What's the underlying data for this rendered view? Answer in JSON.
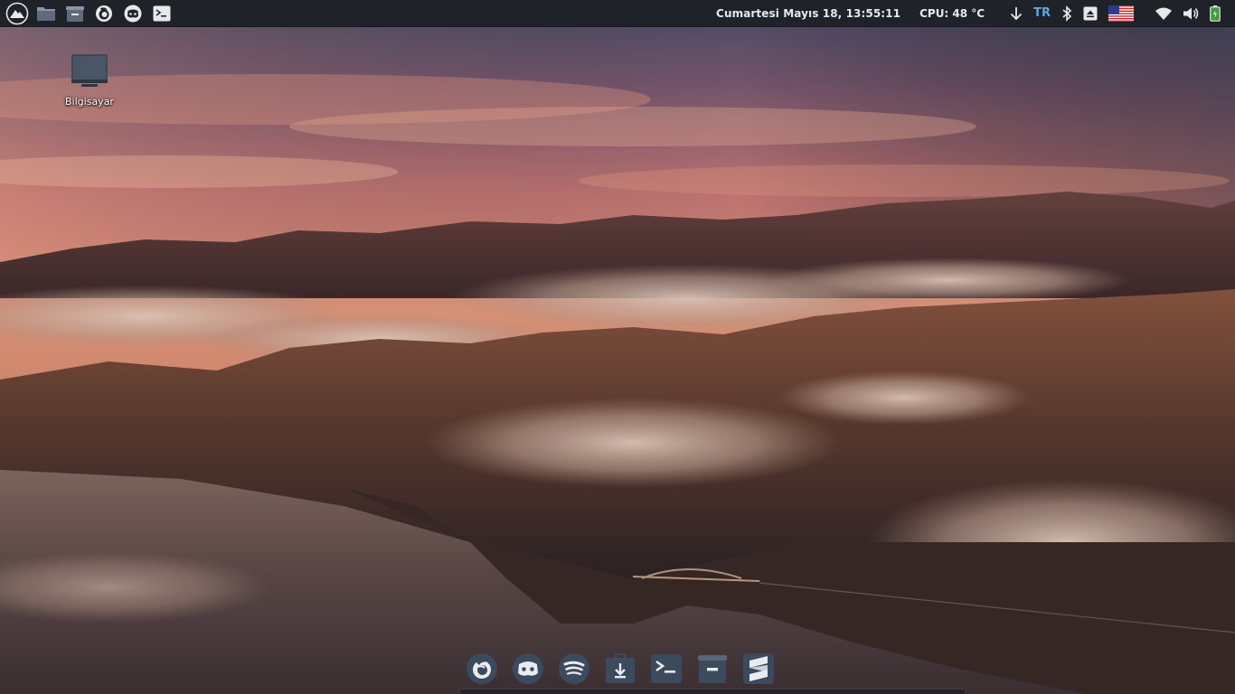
{
  "panel": {
    "clock": "Cumartesi Mayıs 18, 13:55:11",
    "cpu": "CPU: 48 °C",
    "keyboard_layout": "TR",
    "launchers": [
      "distro-logo-icon",
      "file-manager-icon",
      "archive-icon",
      "firefox-icon",
      "discord-icon",
      "terminal-icon"
    ],
    "tray": [
      "download-arrow-icon",
      "bluetooth-icon",
      "eject-icon",
      "us-flag-icon",
      "wifi-icon",
      "volume-icon",
      "battery-icon"
    ]
  },
  "desktop": {
    "icons": [
      {
        "label": "Bilgisayar",
        "icon": "computer-icon"
      }
    ]
  },
  "dock": {
    "items": [
      "firefox-icon",
      "discord-icon",
      "spotify-icon",
      "installer-icon",
      "terminal-icon",
      "archive-icon",
      "sublime-text-icon"
    ]
  },
  "colors": {
    "panel_bg": "#1f2329",
    "accent_blue": "#5aa9e6",
    "battery_green": "#3f9b3a",
    "dock_icon": "#3c4a5e"
  }
}
